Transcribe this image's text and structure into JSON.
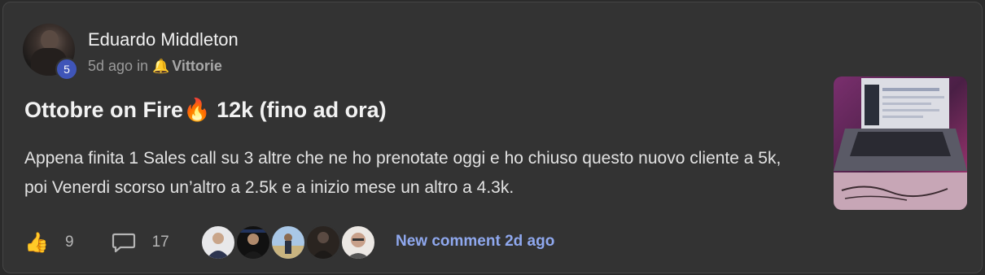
{
  "post": {
    "author": "Eduardo Middleton",
    "level": "5",
    "time": "5d ago",
    "in_label": "in",
    "category_icon": "bell-icon",
    "category": "Vittorie",
    "title_part1": "Ottobre on Fire",
    "title_emoji": "🔥",
    "title_part2": " 12k (fino ad ora)",
    "body": "Appena finita 1 Sales call su 3 altre che ne ho prenotate oggi e ho chiuso questo nuovo cliente a 5k, poi Venerdi scorso un’altro a 2.5k e a inizio mese un altro a 4.3k.",
    "likes": "9",
    "comments": "17",
    "new_comment": "New comment 2d ago"
  },
  "colors": {
    "background": "#2b2b2b",
    "card": "#333333",
    "level_badge": "#3f55b8",
    "link": "#8fa8ee"
  }
}
